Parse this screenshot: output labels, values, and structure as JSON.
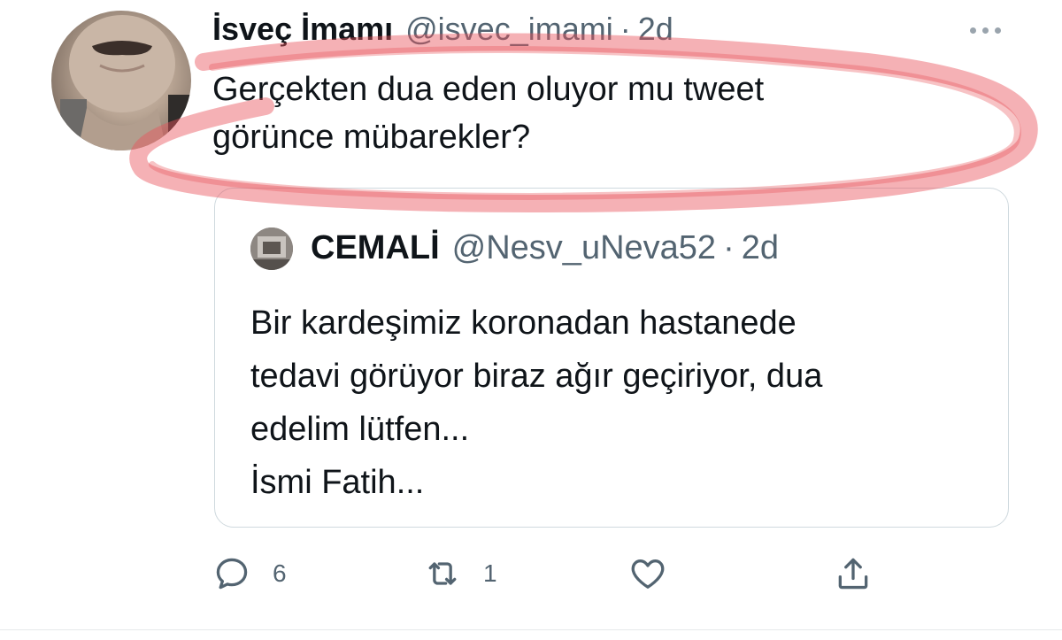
{
  "tweet": {
    "author_name": "İsveç İmamı",
    "handle": "@isvec_imami",
    "separator": "·",
    "time": "2d",
    "text": "Gerçekten dua eden oluyor mu tweet\ngörünce mübarekler?"
  },
  "quoted_tweet": {
    "author_name": "CEMALİ",
    "handle": "@Nesv_uNeva52",
    "separator": "·",
    "time": "2d",
    "text": "Bir kardeşimiz koronadan hastanede\ntedavi görüyor biraz ağır geçiriyor, dua\nedelim lütfen...\nİsmi Fatih..."
  },
  "actions": {
    "reply_count": "6",
    "retweet_count": "1"
  },
  "icons": [
    "more-icon",
    "reply-icon",
    "retweet-icon",
    "like-icon",
    "share-icon"
  ],
  "colors": {
    "text": "#0f1419",
    "secondary": "#536471",
    "border": "#cfd9de",
    "highlight_marker": "#e8525a"
  }
}
